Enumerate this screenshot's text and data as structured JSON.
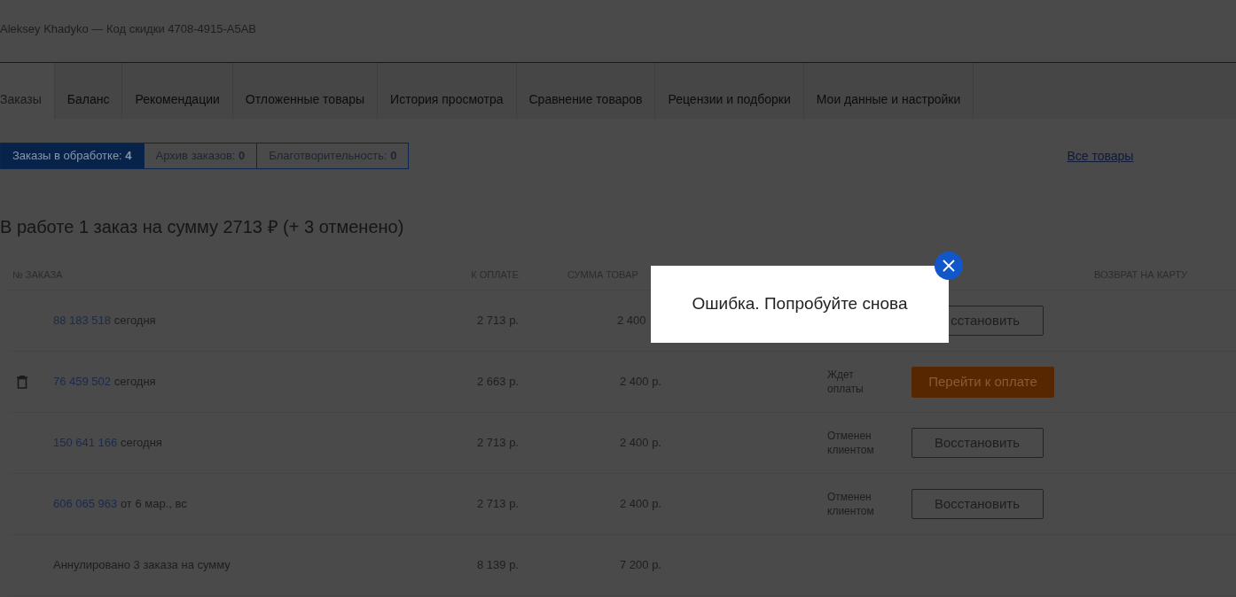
{
  "header": {
    "text": "Aleksey Khadyko — Код скидки 4708-4915-A5AB"
  },
  "tabs": [
    {
      "label": "Заказы",
      "selected": true
    },
    {
      "label": "Баланс",
      "selected": false
    },
    {
      "label": "Рекомендации",
      "selected": false
    },
    {
      "label": "Отложенные товары",
      "selected": false
    },
    {
      "label": "История просмотра",
      "selected": false
    },
    {
      "label": "Сравнение товаров",
      "selected": false
    },
    {
      "label": "Рецензии и подборки",
      "selected": false
    },
    {
      "label": "Мои данные и настройки",
      "selected": false
    }
  ],
  "filters": [
    {
      "label": "Заказы в обработке:",
      "count": "4",
      "selected": true
    },
    {
      "label": "Архив заказов:",
      "count": "0",
      "selected": false
    },
    {
      "label": "Благотворительность:",
      "count": "0",
      "selected": false
    }
  ],
  "all_goods_link": "Все товары",
  "summary_title": "В работе 1 заказ на сумму 2713 ₽ (+ 3 отменено)",
  "table": {
    "columns": [
      "№ ЗАКАЗА",
      "К ОПЛАТЕ",
      "СУММА ТОВАР",
      "ВОЗВРАТ НА КАРТУ"
    ],
    "rows": [
      {
        "kind": "order",
        "deletable": false,
        "number": "88 183 518",
        "date": "сегодня",
        "to_pay": "2 713 р.",
        "goods_sum": "2 400",
        "action": {
          "kind": "restore",
          "label": "сстановить"
        }
      },
      {
        "kind": "order",
        "deletable": true,
        "number": "76 459 502",
        "date": "сегодня",
        "to_pay": "2 663 р.",
        "goods_sum": "2 400 р.",
        "status": "Ждет оплаты",
        "action": {
          "kind": "pay",
          "label": "Перейти к оплате"
        }
      },
      {
        "kind": "order",
        "deletable": false,
        "number": "150 641 166",
        "date": "сегодня",
        "to_pay": "2 713 р.",
        "goods_sum": "2 400 р.",
        "status": "Отменен клиентом",
        "action": {
          "kind": "restore",
          "label": "Восстановить"
        }
      },
      {
        "kind": "order",
        "deletable": false,
        "number": "606 065 963",
        "date": "от 6 мар., вс",
        "to_pay": "2 713 р.",
        "goods_sum": "2 400 р.",
        "status": "Отменен клиентом",
        "action": {
          "kind": "restore",
          "label": "Восстановить"
        }
      },
      {
        "kind": "total",
        "label": "Аннулировано 3 заказа на сумму",
        "to_pay": "8 139 р.",
        "goods_sum": "7 200 р."
      }
    ]
  },
  "dialog": {
    "message": "Ошибка. Попробуйте снова"
  }
}
